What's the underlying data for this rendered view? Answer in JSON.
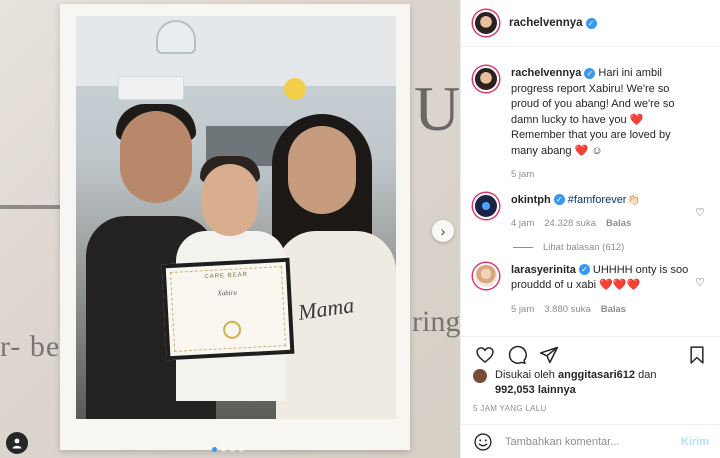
{
  "post": {
    "username": "rachelvennya",
    "photo": {
      "certificate_title": "CARE BEAR",
      "certificate_name": "Xabiru",
      "shirt_text": "Mama",
      "wall_text_left": "r- be",
      "wall_text_right": "ring",
      "wall_letter": "U"
    },
    "carousel": {
      "total": 4,
      "active_index": 0
    }
  },
  "caption": {
    "username": "rachelvennya",
    "text": "Hari ini ambil progress report Xabiru! We're so proud of you abang! And we're so damn lucky to have you",
    "text2": "Remember that you are loved by many abang",
    "heart": "❤️",
    "emoji_end": "☺",
    "time": "5 jam"
  },
  "comments": [
    {
      "username": "okintph",
      "hashtag": "#famforever",
      "emoji": "👏🏻",
      "time": "4 jam",
      "likes": "24.328 suka",
      "reply": "Balas",
      "view_replies": "Lihat balasan (612)"
    },
    {
      "username": "larasyerinita",
      "text": "UHHHH onty is soo prouddd of u xabi",
      "hearts": "❤️❤️❤️",
      "time": "5 jam",
      "likes": "3.880 suka",
      "reply": "Balas"
    }
  ],
  "liked_by": {
    "prefix": "Disukai oleh",
    "user": "anggitasari612",
    "conj": "dan",
    "count": "992,053 lainnya"
  },
  "timestamp": "5 JAM YANG LALU",
  "add_comment": {
    "placeholder": "Tambahkan komentar...",
    "post_label": "Kirim"
  },
  "icons": {
    "like": "heart-outline-icon",
    "comment": "speech-bubble-icon",
    "share": "paper-plane-icon",
    "save": "bookmark-icon",
    "emoji": "smiley-icon",
    "verified": "verified-badge-icon",
    "tagged": "user-tag-icon",
    "next": "chevron-right-icon"
  },
  "colors": {
    "accent": "#3897f0",
    "heart": "#ed4956",
    "muted": "#8e8e8e",
    "post_disabled": "#b2dffc"
  }
}
